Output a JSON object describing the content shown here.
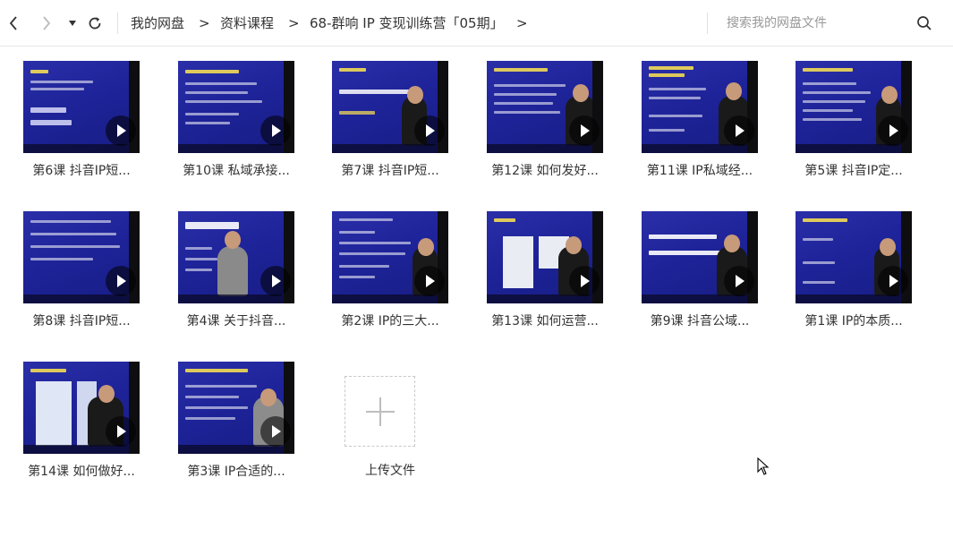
{
  "toolbar": {
    "back_icon": "chevron-left-icon",
    "forward_icon": "chevron-right-icon",
    "history_icon": "caret-down-icon",
    "refresh_icon": "refresh-icon",
    "search_icon": "search-icon"
  },
  "breadcrumb": {
    "items": [
      "我的网盘",
      "资料课程",
      "68-群响 IP 变现训练营「05期」"
    ],
    "separator": ">"
  },
  "search": {
    "placeholder": "搜索我的网盘文件"
  },
  "files": [
    {
      "name": "第6课 抖音IP短..."
    },
    {
      "name": "第10课 私域承接..."
    },
    {
      "name": "第7课 抖音IP短..."
    },
    {
      "name": "第12课 如何发好..."
    },
    {
      "name": "第11课 IP私域经..."
    },
    {
      "name": "第5课 抖音IP定..."
    },
    {
      "name": "第8课 抖音IP短..."
    },
    {
      "name": "第4课 关于抖音..."
    },
    {
      "name": "第2课 IP的三大..."
    },
    {
      "name": "第13课 如何运营..."
    },
    {
      "name": "第9课 抖音公域..."
    },
    {
      "name": "第1课 IP的本质..."
    },
    {
      "name": "第14课 如何做好..."
    },
    {
      "name": "第3课 IP合适的..."
    }
  ],
  "upload": {
    "label": "上传文件",
    "icon": "plus-icon"
  },
  "colors": {
    "thumb_bg": "#1e2399",
    "text": "#333333",
    "placeholder": "#999999"
  }
}
